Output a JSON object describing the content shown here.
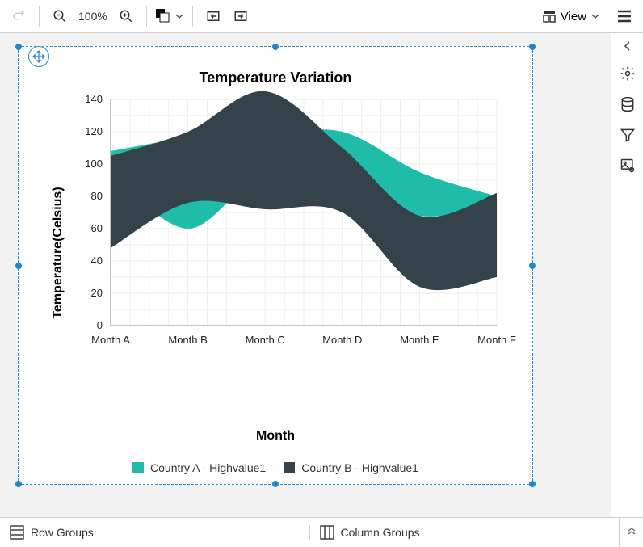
{
  "toolbar": {
    "zoom_label": "100%",
    "view_label": "View"
  },
  "right_panel": {
    "collapse_icon": "chevron-left"
  },
  "bottom": {
    "row_groups": "Row Groups",
    "column_groups": "Column Groups"
  },
  "chart_data": {
    "type": "area",
    "title": "Temperature Variation",
    "xlabel": "Month",
    "ylabel": "Temperature(Celsius)",
    "categories": [
      "Month A",
      "Month B",
      "Month C",
      "Month D",
      "Month E",
      "Month F"
    ],
    "ylim": [
      0,
      140
    ],
    "yticks": [
      0,
      20,
      40,
      60,
      80,
      100,
      120,
      140
    ],
    "series": [
      {
        "name": "Country A - Highvalue1",
        "color": "#1fbcaa",
        "high": [
          108,
          116,
          118,
          120,
          95,
          80
        ],
        "low": [
          95,
          60,
          95,
          88,
          68,
          74
        ]
      },
      {
        "name": "Country B - Highvalue1",
        "color": "#34424a",
        "high": [
          105,
          120,
          145,
          110,
          68,
          82
        ],
        "low": [
          48,
          76,
          72,
          70,
          24,
          30
        ]
      }
    ]
  }
}
